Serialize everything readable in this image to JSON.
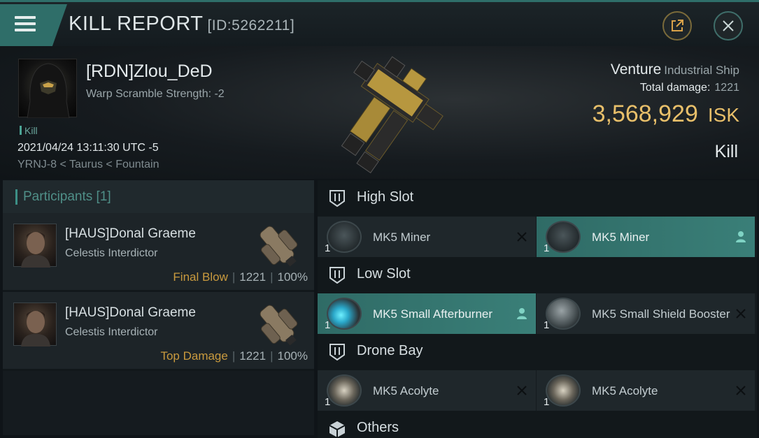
{
  "topbar": {
    "title": "KILL REPORT",
    "report_id": "[ID:5262211]",
    "menu_icon": "hamburger-icon",
    "share_icon": "external-link-icon",
    "close_icon": "close-icon"
  },
  "victim": {
    "name": "[RDN]Zlou_DeD",
    "warp": "Warp Scramble Strength: -2",
    "tag": "Kill",
    "date": "2021/04/24 13:11:30 UTC -5",
    "location": "YRNJ-8 < Taurus < Fountain",
    "ship_name": "Venture",
    "ship_class": "Industrial Ship",
    "damage_label": "Total damage:",
    "damage_value": "1221",
    "isk_value": "3,568,929",
    "isk_unit": "ISK",
    "kind": "Kill"
  },
  "participants": {
    "title": "Participants [1]",
    "rows": [
      {
        "name": "[HAUS]Donal Graeme",
        "ship": "Celestis Interdictor",
        "label": "Final Blow",
        "damage": "1221",
        "percent": "100%"
      },
      {
        "name": "[HAUS]Donal Graeme",
        "ship": "Celestis Interdictor",
        "label": "Top Damage",
        "damage": "1221",
        "percent": "100%"
      }
    ]
  },
  "slots": {
    "high": {
      "title": "High Slot",
      "items": [
        {
          "name": "MK5 Miner",
          "qty": "1",
          "mark": "close-icon"
        },
        {
          "name": "MK5 Miner",
          "qty": "1",
          "mark": "person-icon"
        }
      ]
    },
    "low": {
      "title": "Low Slot",
      "items": [
        {
          "name": "MK5 Small Afterburner",
          "qty": "1",
          "mark": "person-icon"
        },
        {
          "name": "MK5 Small Shield Booster",
          "qty": "1",
          "mark": "close-icon"
        }
      ]
    },
    "drone": {
      "title": "Drone Bay",
      "items": [
        {
          "name": "MK5 Acolyte",
          "qty": "1",
          "mark": "close-icon"
        },
        {
          "name": "MK5 Acolyte",
          "qty": "1",
          "mark": "close-icon"
        }
      ]
    },
    "others": {
      "title": "Others"
    }
  },
  "colors": {
    "accent": "#2f6e69",
    "isk": "#e8bf6a",
    "highlight": "#3a7f78",
    "label": "#c99a3e"
  }
}
